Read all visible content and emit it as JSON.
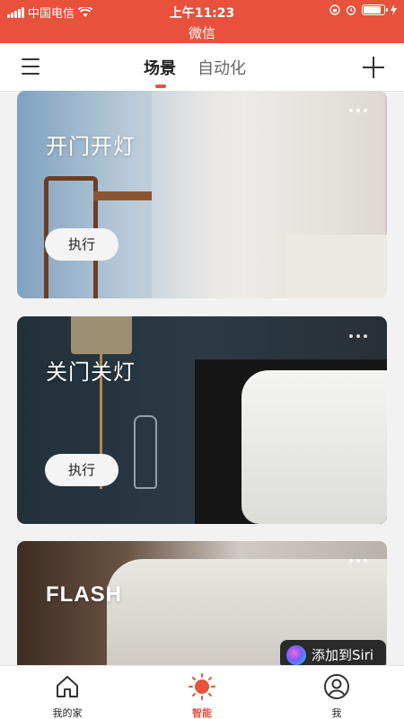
{
  "status_bar": {
    "carrier": "中国电信",
    "time": "上午11:23",
    "app_name": "微信",
    "bg_color": "#e8513c"
  },
  "header": {
    "tabs": [
      {
        "label": "场景",
        "active": true
      },
      {
        "label": "自动化",
        "active": false
      }
    ],
    "icons": [
      "menu-icon",
      "plus-icon"
    ]
  },
  "scenes": [
    {
      "title": "开门开灯",
      "button": "执行"
    },
    {
      "title": "关门关灯",
      "button": "执行"
    },
    {
      "title": "FLASH"
    }
  ],
  "siri": {
    "label": "添加到Siri"
  },
  "tabbar": {
    "items": [
      {
        "label": "我的家",
        "icon": "home-icon",
        "active": false
      },
      {
        "label": "智能",
        "icon": "sun-icon",
        "active": true
      },
      {
        "label": "我",
        "icon": "user-icon",
        "active": false
      }
    ],
    "accent": "#e8513c"
  }
}
